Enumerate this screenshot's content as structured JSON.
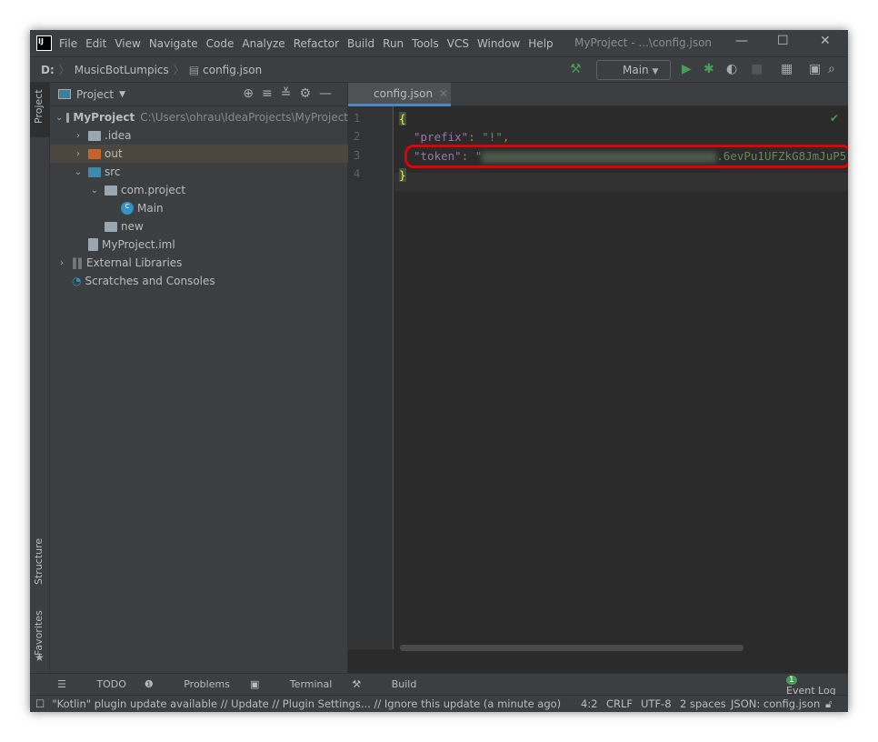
{
  "title_bar": {
    "menu": [
      "File",
      "Edit",
      "View",
      "Navigate",
      "Code",
      "Analyze",
      "Refactor",
      "Build",
      "Run",
      "Tools",
      "VCS",
      "Window",
      "Help"
    ],
    "window_title": "MyProject - ...\\config.json"
  },
  "nav": {
    "crumbs": [
      "D:",
      "MusicBotLumpics",
      "config.json"
    ],
    "run_config": "Main"
  },
  "left_strip": {
    "project": "Project",
    "structure": "Structure",
    "favorites": "Favorites"
  },
  "project_panel": {
    "title": "Project",
    "tree": [
      {
        "label": "MyProject",
        "path": "C:\\Users\\ohrau\\IdeaProjects\\MyProject"
      },
      {
        "label": ".idea"
      },
      {
        "label": "out"
      },
      {
        "label": "src"
      },
      {
        "label": "com.project"
      },
      {
        "label": "Main"
      },
      {
        "label": "new"
      },
      {
        "label": "MyProject.iml"
      },
      {
        "label": "External Libraries"
      },
      {
        "label": "Scratches and Consoles"
      }
    ]
  },
  "editor": {
    "tab": "config.json",
    "line_numbers": [
      "1",
      "2",
      "3",
      "4"
    ],
    "lines": {
      "open": "{",
      "prefix_key": "\"prefix\"",
      "colon": ": ",
      "prefix_val": "\"!\"",
      "comma": ",",
      "token_key": "\"token\"",
      "token_quote": "\"",
      "token_visible": ".6evPu1UFZkG8JmJuP5",
      "close": "}"
    }
  },
  "bottom_tools": {
    "todo": "TODO",
    "problems": "Problems",
    "terminal": "Terminal",
    "build": "Build",
    "event_count": "1",
    "event_log": "Event Log"
  },
  "status": {
    "message": "\"Kotlin\" plugin update available // Update // Plugin Settings... // Ignore this update (a minute ago)",
    "position": "4:2",
    "line_sep": "CRLF",
    "encoding": "UTF-8",
    "indent": "2 spaces",
    "file_type": "JSON: config.json"
  },
  "colors": {
    "highlight": "#e00000",
    "accent": "#4a88c7"
  }
}
